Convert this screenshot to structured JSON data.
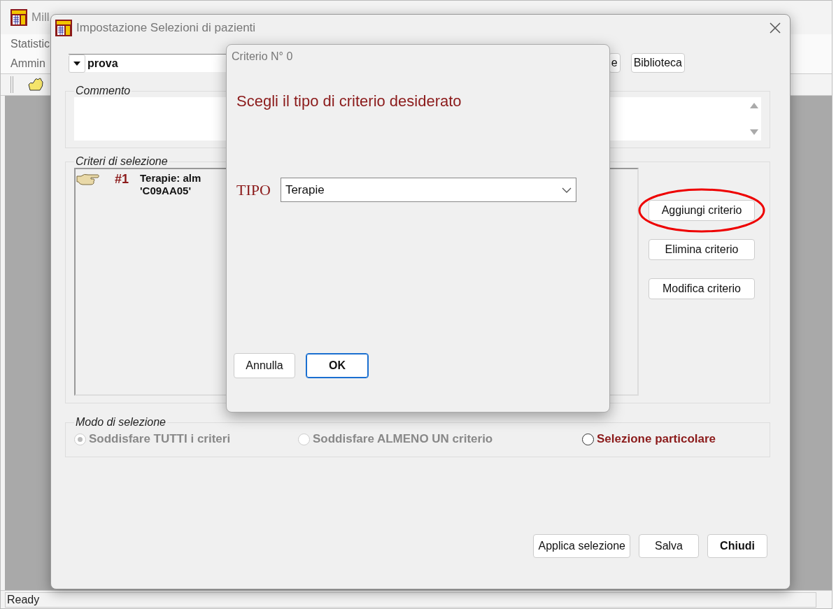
{
  "main_window": {
    "title": "Mill",
    "menu": [
      "Statistic",
      "Ammin"
    ],
    "status_bar": "Ready"
  },
  "dialog": {
    "title": "Impostazione Selezioni di pazienti",
    "name_combo": {
      "value": "prova"
    },
    "top_buttons": [
      "e",
      "Biblioteca"
    ],
    "comment": {
      "label": "Commento"
    },
    "criteria": {
      "label": "Criteri di selezione",
      "items": [
        {
          "number": "#1",
          "lines": [
            "Terapie: alm",
            "'C09AA05'"
          ]
        }
      ],
      "buttons": [
        {
          "label": "Aggiungi criterio",
          "highlighted": true
        },
        {
          "label": "Elimina criterio",
          "highlighted": false
        },
        {
          "label": "Modifica criterio",
          "highlighted": false
        }
      ]
    },
    "mode": {
      "label": "Modo di selezione",
      "options": [
        {
          "label": "Soddisfare TUTTI i criteri",
          "selected": true,
          "disabled": true,
          "kind": "normal"
        },
        {
          "label": "Soddisfare ALMENO UN criterio",
          "selected": false,
          "disabled": true,
          "kind": "normal"
        },
        {
          "label": "Selezione particolare",
          "selected": false,
          "disabled": false,
          "kind": "special"
        }
      ]
    },
    "buttons": [
      {
        "label": "Applica selezione",
        "default": false
      },
      {
        "label": "Salva",
        "default": false
      },
      {
        "label": "Chiudi",
        "default": true
      }
    ]
  },
  "modal": {
    "title": "Criterio N° 0",
    "heading": "Scegli il tipo di criterio desiderato",
    "type_label": "TIPO",
    "type_select": {
      "value": "Terapie"
    },
    "buttons": [
      {
        "label": "Annulla",
        "focused": false
      },
      {
        "label": "OK",
        "focused": true
      }
    ]
  }
}
